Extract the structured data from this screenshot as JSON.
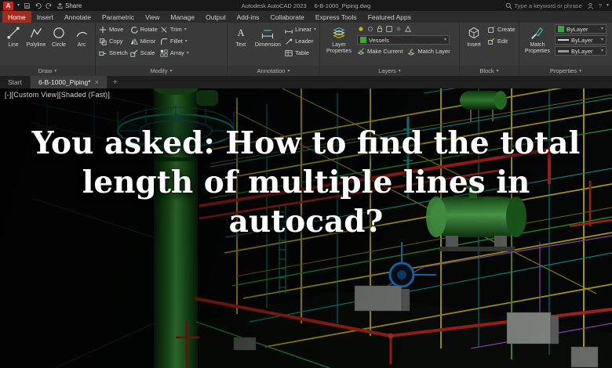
{
  "titlebar": {
    "logo_text": "A",
    "share_label": "Share",
    "app_title": "Autodesk AutoCAD 2023",
    "doc_title": "6-B-1000_Piping.dwg",
    "search_placeholder": "Type a keyword or phrase"
  },
  "ribbon_tabs": [
    "Home",
    "Insert",
    "Annotate",
    "Parametric",
    "View",
    "Manage",
    "Output",
    "Add-ins",
    "Collaborate",
    "Express Tools",
    "Featured Apps"
  ],
  "panels": {
    "draw": {
      "label": "Draw",
      "line": "Line",
      "polyline": "Polyline",
      "circle": "Circle",
      "arc": "Arc"
    },
    "modify": {
      "label": "Modify",
      "move": "Move",
      "copy": "Copy",
      "stretch": "Stretch",
      "rotate": "Rotate",
      "mirror": "Mirror",
      "scale": "Scale",
      "trim": "Trim",
      "fillet": "Fillet",
      "array": "Array"
    },
    "annotation": {
      "label": "Annotation",
      "text": "Text",
      "dimension": "Dimension",
      "linear": "Linear",
      "leader": "Leader",
      "table": "Table"
    },
    "layers": {
      "label": "Layers",
      "layer_properties": "Layer Properties",
      "current_layer": "Vessels",
      "make_current": "Make Current",
      "match_layer": "Match Layer"
    },
    "block": {
      "label": "Block",
      "insert": "Insert",
      "create": "Create",
      "edit": "Edit"
    },
    "properties": {
      "label": "Properties",
      "match_properties": "Match Properties",
      "bylayer": "ByLayer"
    }
  },
  "doc_tabs": {
    "start": "Start",
    "active": "6-B-1000_Piping*"
  },
  "viewport": {
    "controls": "[-][Custom View][Shaded (Fast)]"
  },
  "headline": {
    "line1": "You asked: How to find the total",
    "line2": "length of multiple lines in",
    "line3": "autocad?"
  },
  "icons": {
    "caret": "▾",
    "close": "×",
    "plus": "+",
    "help": "?",
    "text_tool_glyph": "A"
  },
  "colors": {
    "accent_red": "#c0281e",
    "layer_swatch": "#3aa63a",
    "viewport_bg": "#050806",
    "pipe_yellow": "#c9b514",
    "pipe_teal": "#12a0a0",
    "pipe_red": "#c3271b",
    "vessel_green": "#3f9f3f"
  }
}
